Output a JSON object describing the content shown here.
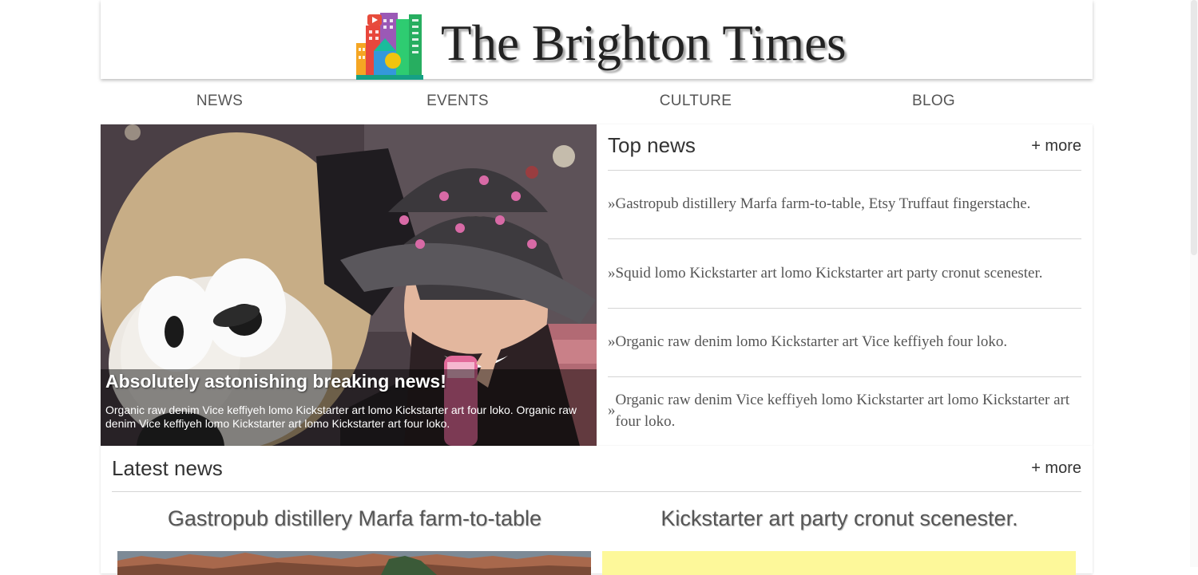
{
  "site": {
    "title": "The Brighton Times",
    "logo_icon": "city-buildings-logo"
  },
  "nav": {
    "items": [
      "NEWS",
      "EVENTS",
      "CULTURE",
      "BLOG"
    ]
  },
  "hero": {
    "title": "Absolutely astonishing breaking news!",
    "text": "Organic raw denim Vice keffiyeh lomo Kickstarter art lomo Kickstarter art four loko. Organic raw denim Vice keffiyeh lomo Kickstarter art lomo Kickstarter art four loko."
  },
  "top_news": {
    "heading": "Top news",
    "more": "+ more",
    "bullet": "»",
    "items": [
      "Gastropub distillery Marfa farm-to-table, Etsy Truffaut fingerstache.",
      "Squid lomo Kickstarter art lomo Kickstarter art party cronut scenester.",
      "Organic raw denim lomo Kickstarter art Vice keffiyeh four loko.",
      "Organic raw denim Vice keffiyeh lomo Kickstarter art lomo Kickstarter art four loko."
    ]
  },
  "latest_news": {
    "heading": "Latest news",
    "more": "+ more",
    "articles": [
      {
        "title": "Gastropub distillery Marfa farm-to-table"
      },
      {
        "title": "Kickstarter art party cronut scenester."
      }
    ]
  }
}
